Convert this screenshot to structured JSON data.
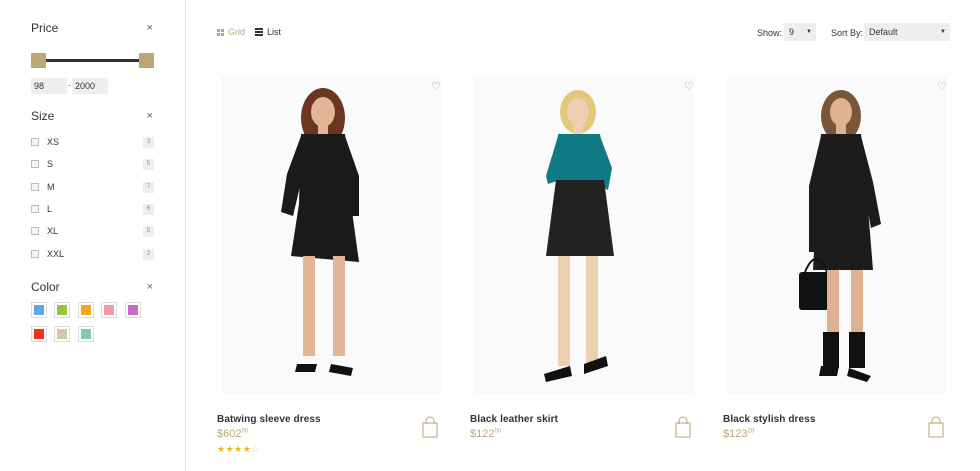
{
  "filters": {
    "price": {
      "title": "Price",
      "min": "98",
      "max": "2000"
    },
    "size": {
      "title": "Size",
      "items": [
        {
          "label": "XS",
          "count": "3"
        },
        {
          "label": "S",
          "count": "5"
        },
        {
          "label": "M",
          "count": "7"
        },
        {
          "label": "L",
          "count": "6"
        },
        {
          "label": "XL",
          "count": "5"
        },
        {
          "label": "XXL",
          "count": "2"
        }
      ]
    },
    "color": {
      "title": "Color",
      "swatches": [
        "#5dabdc",
        "#94c83c",
        "#f4a623",
        "#f49aa4",
        "#c66cc6",
        "#f0311f",
        "#d7c7a8",
        "#7cc9b6"
      ]
    },
    "close_icon": "×"
  },
  "toolbar": {
    "grid_label": "Grid",
    "list_label": "List",
    "show_label": "Show:",
    "show_value": "9",
    "sort_label": "Sort By:",
    "sort_value": "Default"
  },
  "accent_color": "#bba776",
  "products": [
    {
      "name": "Batwing sleeve dress",
      "price": "$602",
      "cents": "00",
      "rating": 4,
      "rating_max": 5
    },
    {
      "name": "Black leather skirt",
      "price": "$122",
      "cents": "00"
    },
    {
      "name": "Black stylish dress",
      "price": "$123",
      "cents": "20"
    }
  ]
}
